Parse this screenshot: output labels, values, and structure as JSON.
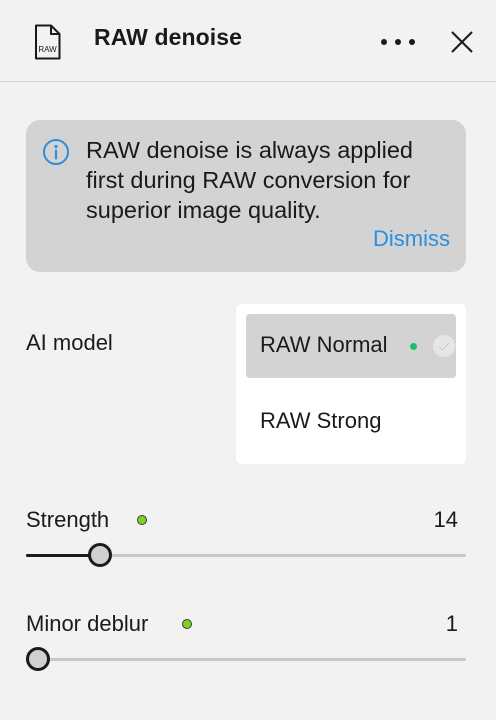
{
  "header": {
    "icon": "raw-file-icon",
    "icon_text": "RAW",
    "title": "RAW denoise",
    "more_icon": "more-horizontal-icon",
    "close_icon": "close-icon"
  },
  "info_card": {
    "icon": "info-icon",
    "message": "RAW denoise is always applied first during RAW conversion for superior image quality.",
    "dismiss_label": "Dismiss"
  },
  "ai_model": {
    "label": "AI model",
    "options": [
      {
        "label": "RAW Normal",
        "selected": true,
        "status_dot": true
      },
      {
        "label": "RAW Strong",
        "selected": false,
        "status_dot": false
      }
    ]
  },
  "sliders": {
    "strength": {
      "label": "Strength",
      "value": "14",
      "fraction": 0.15
    },
    "minor_deblur": {
      "label": "Minor deblur",
      "value": "1",
      "fraction": 0.0
    }
  },
  "colors": {
    "accent": "#2b8fe0",
    "status_green": "#17c06a",
    "changed_dot": "#7ed321",
    "card_bg": "#d3d3d3",
    "panel_bg": "#f2f2f2"
  }
}
